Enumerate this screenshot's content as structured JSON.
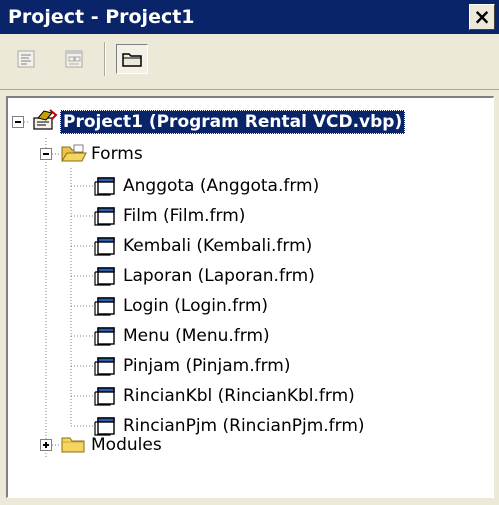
{
  "window": {
    "title": "Project - Project1",
    "close_glyph": "×"
  },
  "toolbar": {
    "buttons": [
      {
        "name": "view-code-button",
        "icon": "view-code-icon",
        "enabled": false
      },
      {
        "name": "view-object-button",
        "icon": "view-object-icon",
        "enabled": false
      },
      {
        "name": "toggle-folders-button",
        "icon": "folder-icon",
        "enabled": true,
        "pressed": true
      }
    ]
  },
  "tree": {
    "root": {
      "label": "Project1 (Program Rental VCD.vbp)",
      "icon": "project-icon",
      "expanded": true,
      "selected": true
    },
    "folders": [
      {
        "label": "Forms",
        "icon": "open-folder-icon",
        "expanded": true,
        "items": [
          {
            "label": "Anggota (Anggota.frm)",
            "icon": "form-icon"
          },
          {
            "label": "Film (Film.frm)",
            "icon": "form-icon"
          },
          {
            "label": "Kembali (Kembali.frm)",
            "icon": "form-icon"
          },
          {
            "label": "Laporan (Laporan.frm)",
            "icon": "form-icon"
          },
          {
            "label": "Login (Login.frm)",
            "icon": "form-icon"
          },
          {
            "label": "Menu (Menu.frm)",
            "icon": "form-icon"
          },
          {
            "label": "Pinjam (Pinjam.frm)",
            "icon": "form-icon"
          },
          {
            "label": "RincianKbl (RincianKbl.frm)",
            "icon": "form-icon"
          },
          {
            "label": "RincianPjm (RincianPjm.frm)",
            "icon": "form-icon"
          }
        ]
      },
      {
        "label": "Modules",
        "icon": "closed-folder-icon",
        "expanded": false,
        "items": []
      }
    ]
  },
  "colors": {
    "titlebar": "#0a246a",
    "selection": "#0a246a",
    "chrome": "#ece9d8",
    "folder": "#f5d562"
  }
}
